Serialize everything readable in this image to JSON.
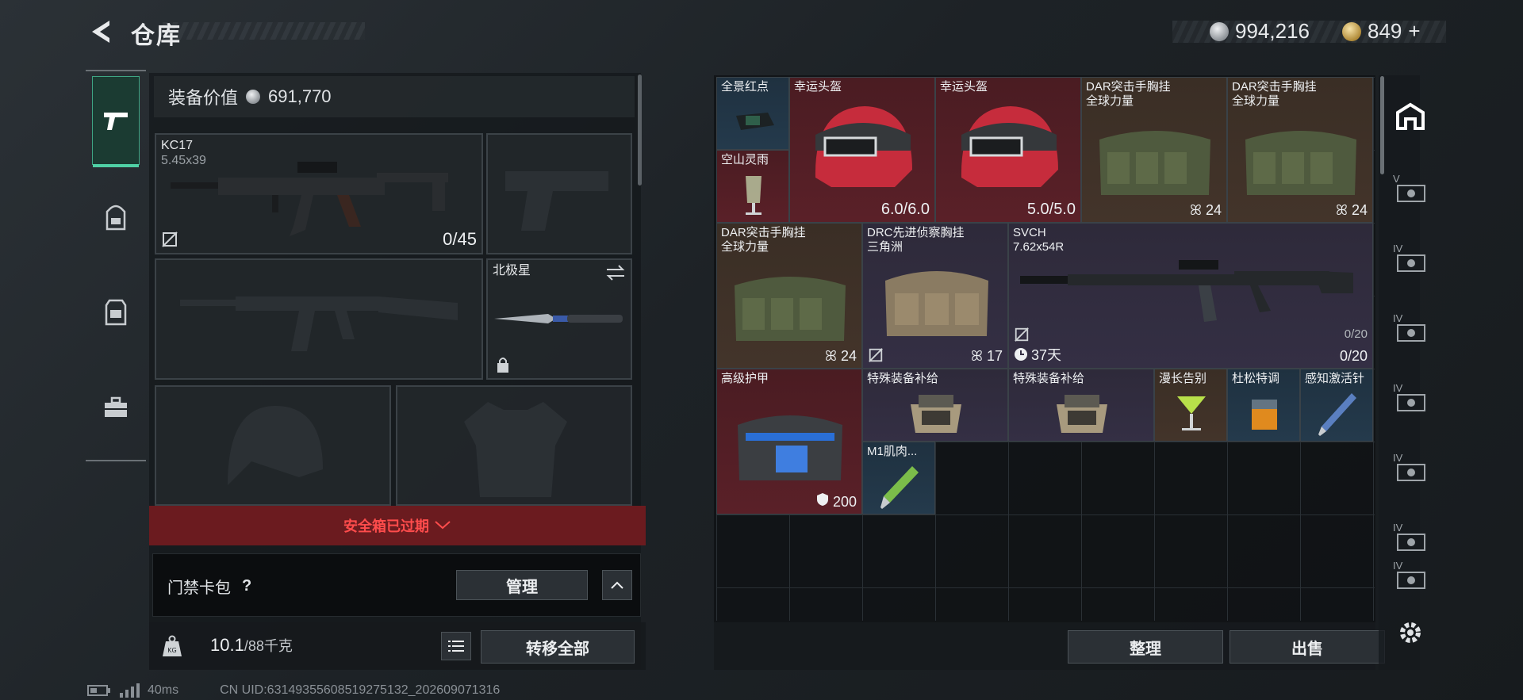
{
  "header": {
    "title": "仓库",
    "currency_silver": "994,216",
    "currency_gold": "849",
    "plus": "+"
  },
  "left_nav": {
    "icons": [
      "pistol-icon",
      "backpack-icon",
      "vest-icon",
      "briefcase-icon"
    ]
  },
  "equipment": {
    "value_label": "装备价值",
    "value": "691,770",
    "primary": {
      "name": "KC17",
      "ammo": "5.45x39",
      "count": "0/45"
    },
    "melee": {
      "name": "北极星"
    },
    "safebox_expired": "安全箱已过期",
    "keycard_label": "门禁卡包",
    "help": "?",
    "manage": "管理",
    "weight": "10.1",
    "weight_unit": "/88千克",
    "transfer_all": "转移全部"
  },
  "stash": {
    "items": [
      {
        "name": "全景红点",
        "sub": "",
        "value": ""
      },
      {
        "name": "空山灵雨",
        "sub": "",
        "value": ""
      },
      {
        "name": "幸运头盔",
        "sub": "",
        "value": "6.0/6.0"
      },
      {
        "name": "幸运头盔",
        "sub": "",
        "value": "5.0/5.0"
      },
      {
        "name": "DAR突击手胸挂",
        "sub": "全球力量",
        "value": "24"
      },
      {
        "name": "DAR突击手胸挂",
        "sub": "全球力量",
        "value": "24"
      },
      {
        "name": "DAR突击手胸挂",
        "sub": "全球力量",
        "value": "24"
      },
      {
        "name": "DRC先进侦察胸挂",
        "sub": "三角洲",
        "value": "17"
      },
      {
        "name": "SVCH",
        "sub": "7.62x54R",
        "value": "0/20",
        "ammo_small": "0/20",
        "timer": "37天"
      },
      {
        "name": "高级护甲",
        "sub": "",
        "value": "200"
      },
      {
        "name": "特殊装备补给",
        "sub": "",
        "value": ""
      },
      {
        "name": "特殊装备补给",
        "sub": "",
        "value": ""
      },
      {
        "name": "漫长告别",
        "sub": "",
        "value": ""
      },
      {
        "name": "杜松特调",
        "sub": "",
        "value": ""
      },
      {
        "name": "感知激活针",
        "sub": "",
        "value": ""
      },
      {
        "name": "M1肌肉...",
        "sub": "",
        "value": ""
      }
    ],
    "sort": "整理",
    "sell": "出售"
  },
  "right_tabs": {
    "tier": "IV",
    "tier5": "V"
  },
  "status": {
    "ping": "40ms",
    "uid": "CN UID:63149355608519275132_202609071316"
  },
  "colors": {
    "accent": "#4fd1a5",
    "expired": "#ff4c4c",
    "rare_red": "#5a2028",
    "gold": "#3a2e25"
  }
}
